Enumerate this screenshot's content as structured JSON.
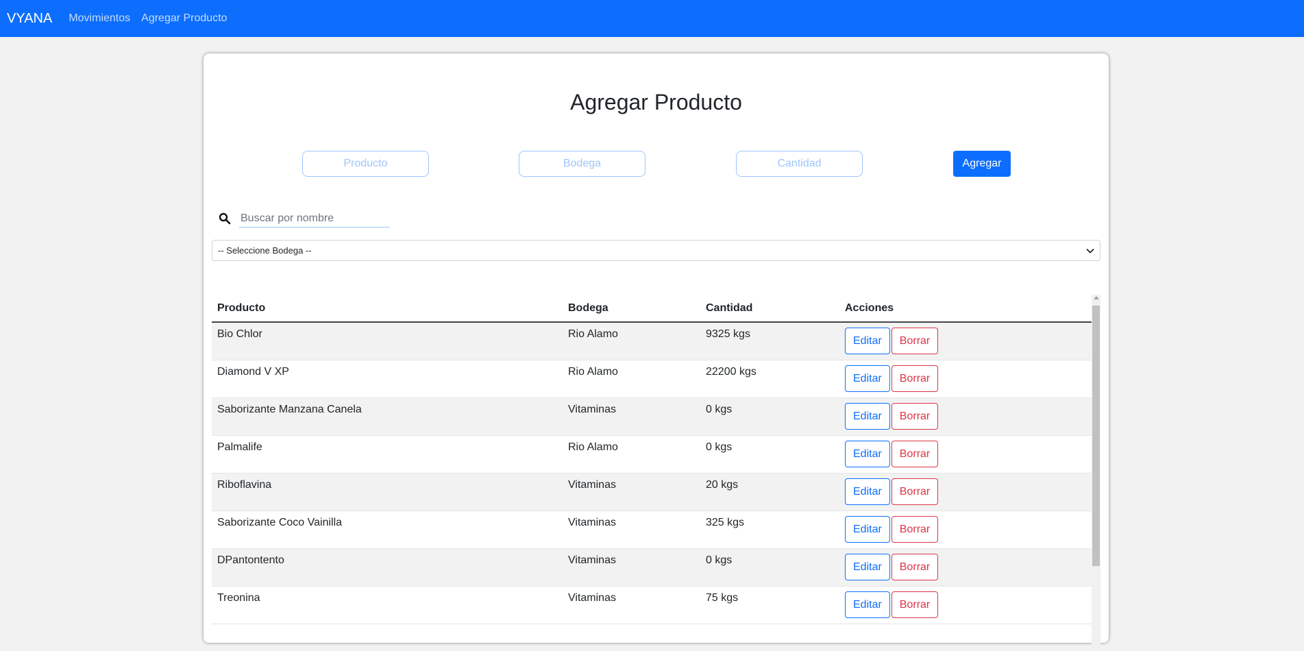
{
  "navbar": {
    "brand": "VYANA",
    "links": [
      "Movimientos",
      "Agregar Producto"
    ]
  },
  "page": {
    "title": "Agregar Producto"
  },
  "form": {
    "product_placeholder": "Producto",
    "bodega_placeholder": "Bodega",
    "quantity_placeholder": "Cantidad",
    "add_label": "Agregar"
  },
  "search": {
    "placeholder": "Buscar por nombre"
  },
  "bodega_select": {
    "selected": "-- Seleccione Bodega --"
  },
  "table": {
    "headers": [
      "Producto",
      "Bodega",
      "Cantidad",
      "Acciones"
    ],
    "edit_label": "Editar",
    "delete_label": "Borrar",
    "rows": [
      {
        "producto": "Bio Chlor",
        "bodega": "Rio Alamo",
        "cantidad": "9325 kgs"
      },
      {
        "producto": "Diamond V XP",
        "bodega": "Rio Alamo",
        "cantidad": "22200 kgs"
      },
      {
        "producto": "Saborizante Manzana Canela",
        "bodega": "Vitaminas",
        "cantidad": "0 kgs"
      },
      {
        "producto": "Palmalife",
        "bodega": "Rio Alamo",
        "cantidad": "0 kgs"
      },
      {
        "producto": "Riboflavina",
        "bodega": "Vitaminas",
        "cantidad": "20 kgs"
      },
      {
        "producto": "Saborizante Coco Vainilla",
        "bodega": "Vitaminas",
        "cantidad": "325 kgs"
      },
      {
        "producto": "DPantontento",
        "bodega": "Vitaminas",
        "cantidad": "0 kgs"
      },
      {
        "producto": "Treonina",
        "bodega": "Vitaminas",
        "cantidad": "75 kgs"
      }
    ]
  },
  "colors": {
    "primary": "#0d6efd",
    "danger": "#dc3545",
    "background": "#f2f2f2"
  }
}
